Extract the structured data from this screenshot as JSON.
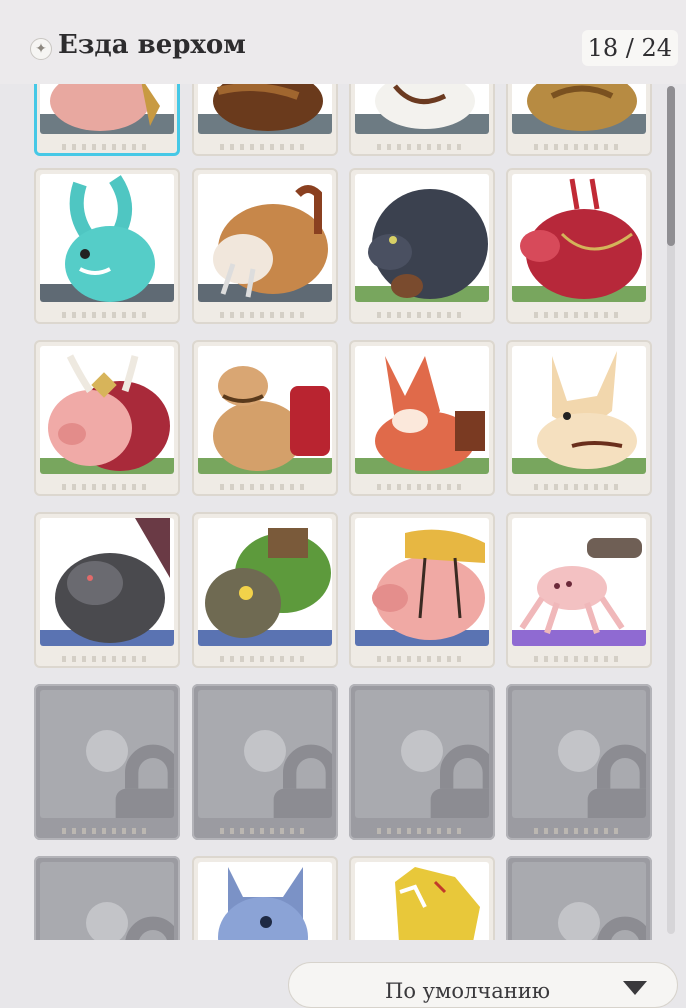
{
  "header": {
    "title": "Езда верхом",
    "count": "18 / 24"
  },
  "sort": {
    "label": "По умолчанию"
  },
  "colors": {
    "selected_border": "#46c8e6",
    "locked_tile": "#9b9ba1",
    "ground_green": "#7fb26a"
  },
  "mounts": [
    {
      "name": "pink-pig-mount",
      "status": "unlocked",
      "selected": true
    },
    {
      "name": "brown-boar-mount",
      "status": "unlocked"
    },
    {
      "name": "white-horse-mount",
      "status": "unlocked"
    },
    {
      "name": "golden-lion-mount",
      "status": "unlocked"
    },
    {
      "name": "blue-axolotl-rabbit-mount",
      "status": "unlocked"
    },
    {
      "name": "walrus-mount",
      "status": "unlocked"
    },
    {
      "name": "black-wolf-bear-mount",
      "status": "unlocked"
    },
    {
      "name": "red-pig-mount",
      "status": "unlocked"
    },
    {
      "name": "pig-with-horned-helmet-mount",
      "status": "unlocked"
    },
    {
      "name": "camel-mount",
      "status": "unlocked"
    },
    {
      "name": "red-fox-mount",
      "status": "unlocked"
    },
    {
      "name": "fennec-fox-mount",
      "status": "unlocked"
    },
    {
      "name": "grey-wolf-mount",
      "status": "unlocked"
    },
    {
      "name": "green-frog-turtle-mount",
      "status": "unlocked"
    },
    {
      "name": "pink-pig-saddle-mount",
      "status": "unlocked"
    },
    {
      "name": "pink-spider-mount",
      "status": "unlocked"
    },
    {
      "name": "locked-slot",
      "status": "locked"
    },
    {
      "name": "locked-slot",
      "status": "locked"
    },
    {
      "name": "locked-slot",
      "status": "locked"
    },
    {
      "name": "locked-slot",
      "status": "locked"
    },
    {
      "name": "locked-slot",
      "status": "locked"
    },
    {
      "name": "blue-wolf-mount",
      "status": "unlocked"
    },
    {
      "name": "golden-dragon-mount",
      "status": "unlocked"
    },
    {
      "name": "locked-slot",
      "status": "locked"
    }
  ]
}
